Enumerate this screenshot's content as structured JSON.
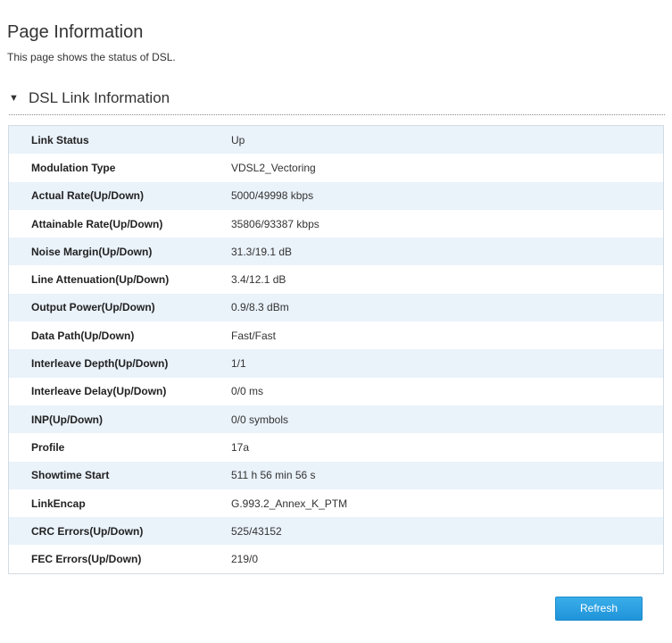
{
  "page": {
    "title": "Page Information",
    "description": "This page shows the status of DSL."
  },
  "section": {
    "toggle_icon": "▼",
    "title": "DSL Link Information"
  },
  "rows": [
    {
      "label": "Link Status",
      "value": "Up"
    },
    {
      "label": "Modulation Type",
      "value": "VDSL2_Vectoring"
    },
    {
      "label": "Actual Rate(Up/Down)",
      "value": "5000/49998 kbps"
    },
    {
      "label": "Attainable Rate(Up/Down)",
      "value": "35806/93387 kbps"
    },
    {
      "label": "Noise Margin(Up/Down)",
      "value": "31.3/19.1 dB"
    },
    {
      "label": "Line Attenuation(Up/Down)",
      "value": "3.4/12.1 dB"
    },
    {
      "label": "Output Power(Up/Down)",
      "value": "0.9/8.3 dBm"
    },
    {
      "label": "Data Path(Up/Down)",
      "value": "Fast/Fast"
    },
    {
      "label": "Interleave Depth(Up/Down)",
      "value": "1/1"
    },
    {
      "label": "Interleave Delay(Up/Down)",
      "value": "0/0 ms"
    },
    {
      "label": "INP(Up/Down)",
      "value": "0/0 symbols"
    },
    {
      "label": "Profile",
      "value": "17a"
    },
    {
      "label": "Showtime Start",
      "value": "511 h 56 min 56 s"
    },
    {
      "label": "LinkEncap",
      "value": "G.993.2_Annex_K_PTM"
    },
    {
      "label": "CRC Errors(Up/Down)",
      "value": "525/43152"
    },
    {
      "label": "FEC Errors(Up/Down)",
      "value": "219/0"
    }
  ],
  "actions": {
    "refresh_label": "Refresh"
  },
  "colors": {
    "row_alt": "#eaf2fa",
    "button": "#2a9fe0",
    "border": "#d3dbe2"
  }
}
